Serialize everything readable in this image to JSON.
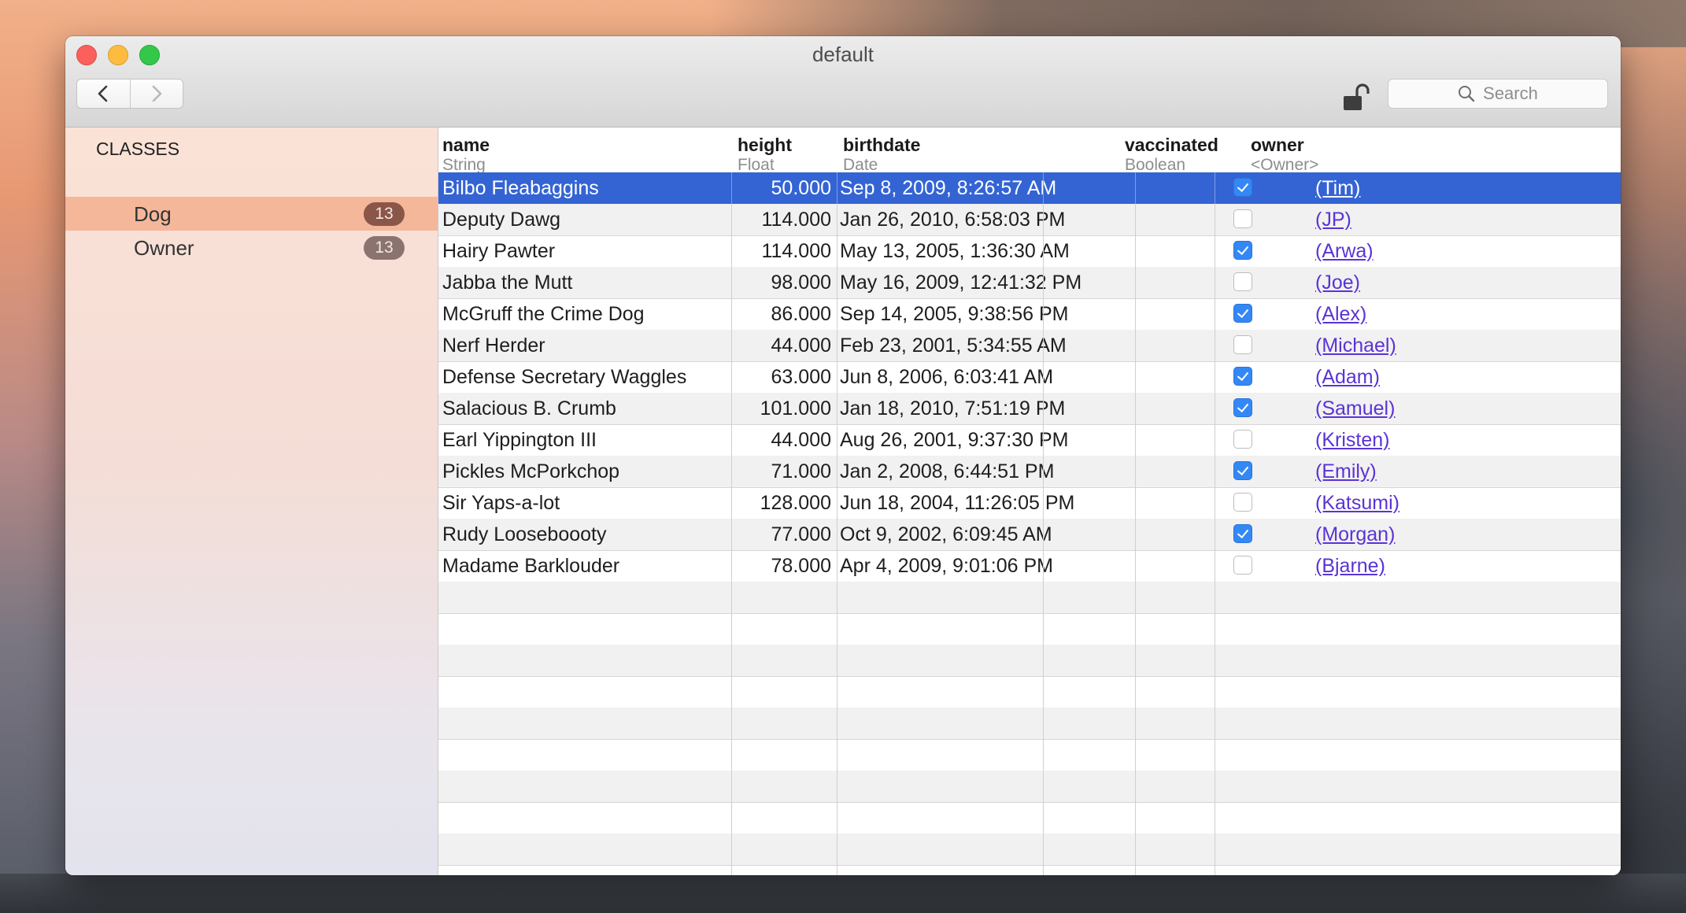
{
  "window": {
    "title": "default"
  },
  "search": {
    "placeholder": "Search"
  },
  "sidebar": {
    "heading": "CLASSES",
    "items": [
      {
        "label": "Dog",
        "count": "13",
        "selected": true
      },
      {
        "label": "Owner",
        "count": "13",
        "selected": false
      }
    ]
  },
  "columns": [
    {
      "name": "name",
      "type": "String"
    },
    {
      "name": "height",
      "type": "Float"
    },
    {
      "name": "birthdate",
      "type": "Date"
    },
    {
      "name": "vaccinated",
      "type": "Boolean"
    },
    {
      "name": "owner",
      "type": "<Owner>"
    }
  ],
  "rows": [
    {
      "name": "Bilbo Fleabaggins",
      "height": "50.000",
      "birthdate": "Sep 8, 2009, 8:26:57 AM",
      "vaccinated": true,
      "owner": "(Tim)"
    },
    {
      "name": "Deputy Dawg",
      "height": "114.000",
      "birthdate": "Jan 26, 2010, 6:58:03 PM",
      "vaccinated": false,
      "owner": "(JP)"
    },
    {
      "name": "Hairy Pawter",
      "height": "114.000",
      "birthdate": "May 13, 2005, 1:36:30 AM",
      "vaccinated": true,
      "owner": "(Arwa)"
    },
    {
      "name": "Jabba the Mutt",
      "height": "98.000",
      "birthdate": "May 16, 2009, 12:41:32 PM",
      "vaccinated": false,
      "owner": "(Joe)"
    },
    {
      "name": "McGruff the Crime Dog",
      "height": "86.000",
      "birthdate": "Sep 14, 2005, 9:38:56 PM",
      "vaccinated": true,
      "owner": "(Alex)"
    },
    {
      "name": "Nerf Herder",
      "height": "44.000",
      "birthdate": "Feb 23, 2001, 5:34:55 AM",
      "vaccinated": false,
      "owner": "(Michael)"
    },
    {
      "name": "Defense Secretary Waggles",
      "height": "63.000",
      "birthdate": "Jun 8, 2006, 6:03:41 AM",
      "vaccinated": true,
      "owner": "(Adam)"
    },
    {
      "name": "Salacious B. Crumb",
      "height": "101.000",
      "birthdate": "Jan 18, 2010, 7:51:19 PM",
      "vaccinated": true,
      "owner": "(Samuel)"
    },
    {
      "name": "Earl Yippington III",
      "height": "44.000",
      "birthdate": "Aug 26, 2001, 9:37:30 PM",
      "vaccinated": false,
      "owner": "(Kristen)"
    },
    {
      "name": "Pickles McPorkchop",
      "height": "71.000",
      "birthdate": "Jan 2, 2008, 6:44:51 PM",
      "vaccinated": true,
      "owner": "(Emily)"
    },
    {
      "name": "Sir Yaps-a-lot",
      "height": "128.000",
      "birthdate": "Jun 18, 2004, 11:26:05 PM",
      "vaccinated": false,
      "owner": "(Katsumi)"
    },
    {
      "name": "Rudy Looseboooty",
      "height": "77.000",
      "birthdate": "Oct 9, 2002, 6:09:45 AM",
      "vaccinated": true,
      "owner": "(Morgan)"
    },
    {
      "name": "Madame Barklouder",
      "height": "78.000",
      "birthdate": "Apr 4, 2009, 9:01:06 PM",
      "vaccinated": false,
      "owner": "(Bjarne)"
    }
  ],
  "selected_row_index": 0,
  "colors": {
    "selection": "#3464d4",
    "sidebar_selection": "#f4b79a",
    "badge": "#8a5649",
    "link": "#5a33d6",
    "checkbox_checked": "#3488f5"
  }
}
